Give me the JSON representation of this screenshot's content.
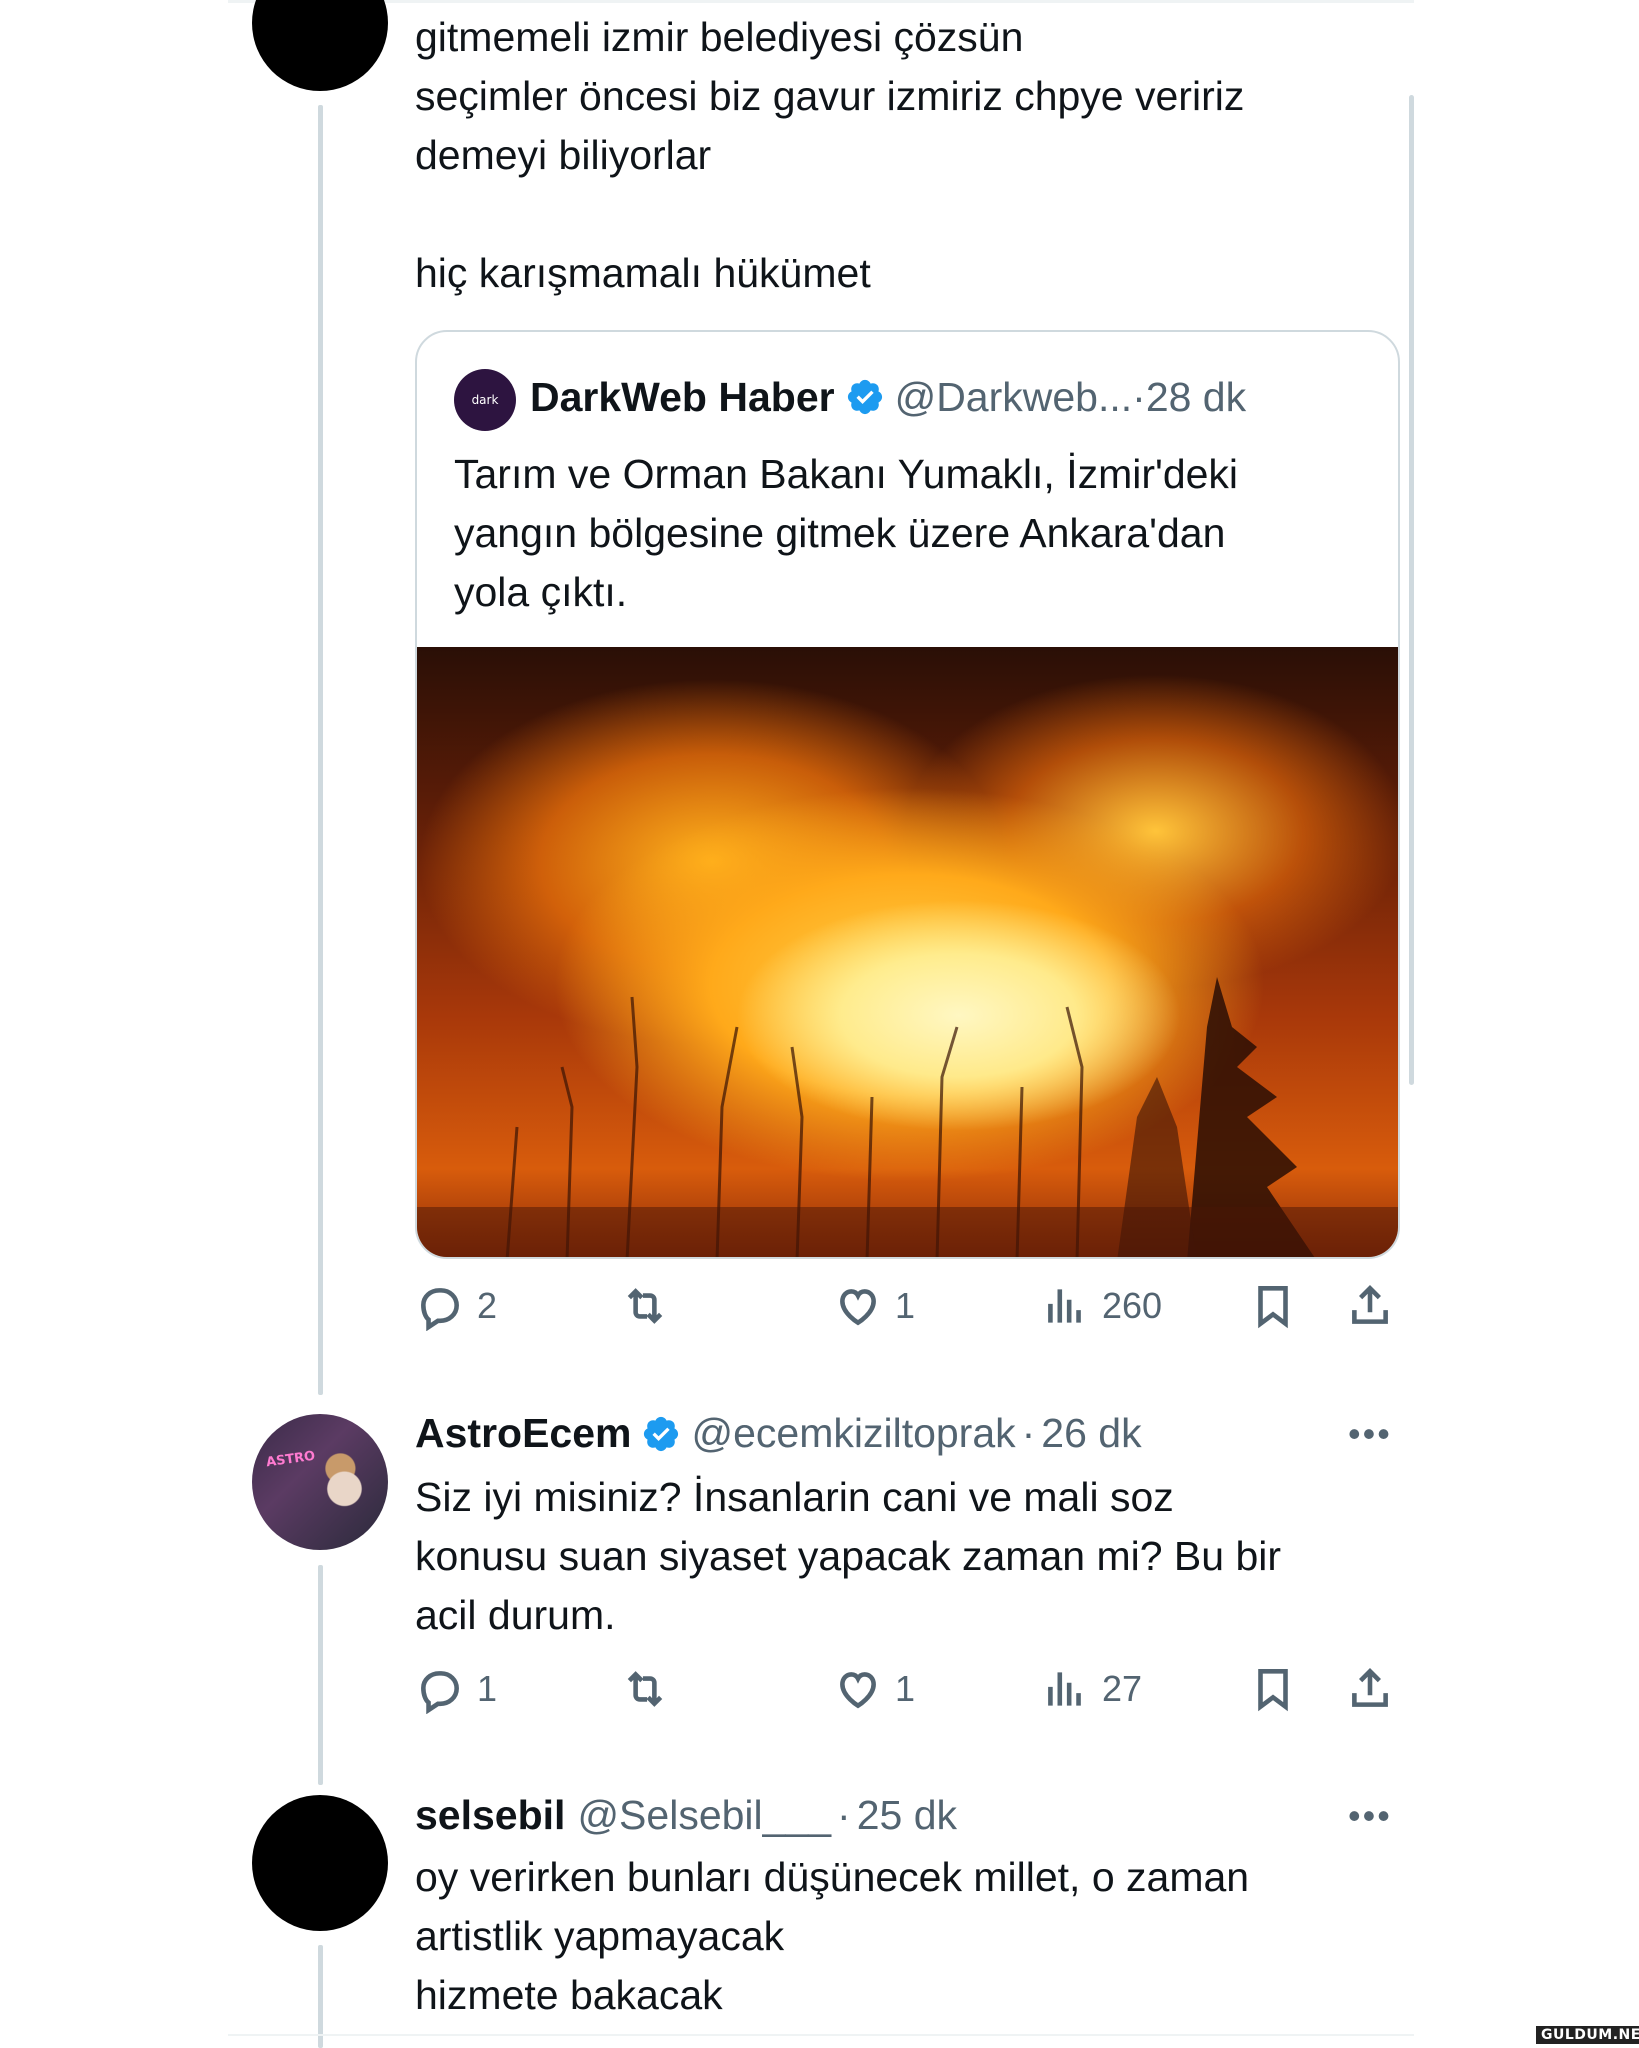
{
  "tweets": [
    {
      "text": "gitmemeli izmir belediyesi çözsün\nseçimler öncesi biz gavur izmiriz chpye veririz\ndemeyi biliyorlar\n\n hiç karışmamalı hükümet",
      "quote": {
        "name": "DarkWeb Haber",
        "handle": "@Darkweb...",
        "separator": "·",
        "time": "28 dk",
        "avatar_text": "dark",
        "text": "Tarım ve Orman Bakanı Yumaklı, İzmir'deki\nyangın bölgesine gitmek üzere Ankara'dan\nyola çıktı."
      },
      "stats": {
        "replies": "2",
        "likes": "1",
        "views": "260"
      }
    },
    {
      "name": "AstroEcem",
      "handle": "@ecemkiziltoprak",
      "separator": "·",
      "time": "26 dk",
      "avatar_text": "ASTRO",
      "text": "Siz iyi misiniz? İnsanlarin cani ve mali soz\nkonusu suan siyaset yapacak zaman mi? Bu bir\nacil durum.",
      "stats": {
        "replies": "1",
        "likes": "1",
        "views": "27"
      }
    },
    {
      "name": "selsebil",
      "handle": "@Selsebil___",
      "separator": "·",
      "time": "25 dk",
      "text": "oy verirken bunları düşünecek millet, o zaman\nartistlik yapmayacak\nhizmete bakacak"
    }
  ],
  "more_label": "•••",
  "watermark": "GULDUM.NET",
  "icons": [
    "reply-icon",
    "retweet-icon",
    "like-icon",
    "views-icon",
    "bookmark-icon",
    "share-icon",
    "verified-icon",
    "more-icon"
  ],
  "colors": {
    "text": "#0f1419",
    "secondary": "#536471",
    "verified": "#1d9bf0",
    "border": "#cfd9de"
  }
}
